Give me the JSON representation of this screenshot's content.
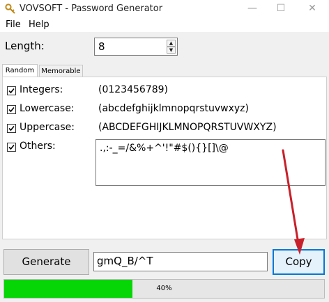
{
  "window": {
    "title": "VOVSOFT - Password Generator",
    "minimize_glyph": "—",
    "maximize_glyph": "☐",
    "close_glyph": "✕",
    "app_icon": "key-icon"
  },
  "menu": {
    "items": [
      {
        "label": "File"
      },
      {
        "label": "Help"
      }
    ]
  },
  "length": {
    "label": "Length:",
    "value": "8"
  },
  "tabs": [
    {
      "label": "Random",
      "active": true
    },
    {
      "label": "Memorable",
      "active": false
    }
  ],
  "options": [
    {
      "label": "Integers:",
      "checked": true,
      "value": "(0123456789)"
    },
    {
      "label": "Lowercase:",
      "checked": true,
      "value": "(abcdefghijklmnopqrstuvwxyz)"
    },
    {
      "label": "Uppercase:",
      "checked": true,
      "value": "(ABCDEFGHIJKLMNOPQRSTUVWXYZ)"
    },
    {
      "label": "Others:",
      "checked": true,
      "value": ".,:-_=/&%+^'!\"#$(){}[]\\@"
    }
  ],
  "generate_button": {
    "label": "Generate"
  },
  "password": {
    "value": "gmQ_B/^T"
  },
  "copy_button": {
    "label": "Copy"
  },
  "progress": {
    "fraction": 0.4,
    "label": "40%"
  },
  "colors": {
    "progress": "#06d606",
    "accent": "#0078d7",
    "arrow": "#c8202a"
  }
}
